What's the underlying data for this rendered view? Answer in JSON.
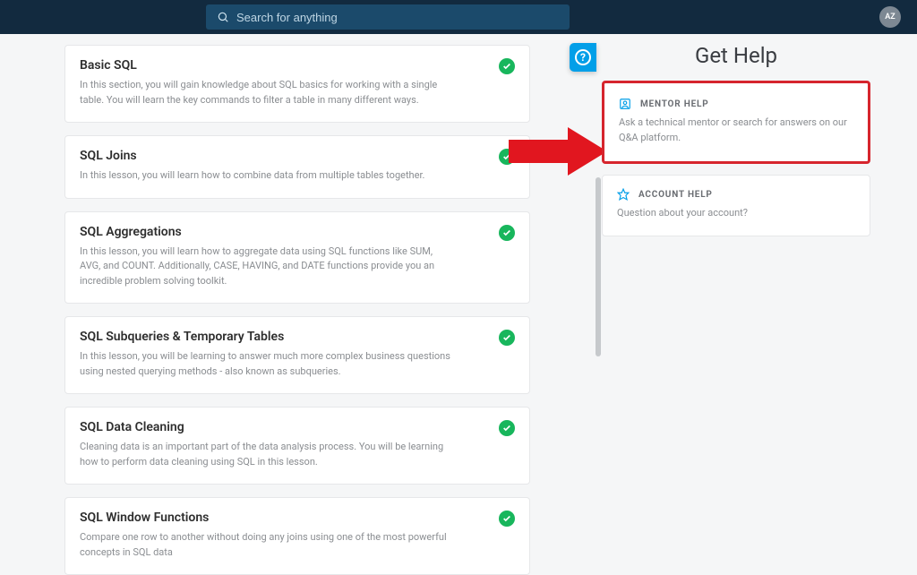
{
  "header": {
    "search_placeholder": "Search for anything",
    "avatar_initials": "AZ"
  },
  "lessons": [
    {
      "title": "Basic SQL",
      "desc": "In this section, you will gain knowledge about SQL basics for working with a single table. You will learn the key commands to filter a table in many different ways."
    },
    {
      "title": "SQL Joins",
      "desc": "In this lesson, you will learn how to combine data from multiple tables together."
    },
    {
      "title": "SQL Aggregations",
      "desc": "In this lesson, you will learn how to aggregate data using SQL functions like SUM, AVG, and COUNT. Additionally, CASE, HAVING, and DATE functions provide you an incredible problem solving toolkit."
    },
    {
      "title": "SQL Subqueries & Temporary Tables",
      "desc": "In this lesson, you will be learning to answer much more complex business questions using nested querying methods - also known as subqueries."
    },
    {
      "title": "SQL Data Cleaning",
      "desc": "Cleaning data is an important part of the data analysis process. You will be learning how to perform data cleaning using SQL in this lesson."
    },
    {
      "title": "SQL Window Functions",
      "desc": "Compare one row to another without doing any joins using one of the most powerful concepts in SQL data"
    }
  ],
  "help": {
    "panel_title": "Get Help",
    "mentor": {
      "label": "MENTOR HELP",
      "desc": "Ask a technical mentor or search for answers on our Q&A platform."
    },
    "account": {
      "label": "ACCOUNT HELP",
      "desc": "Question about your account?"
    }
  }
}
